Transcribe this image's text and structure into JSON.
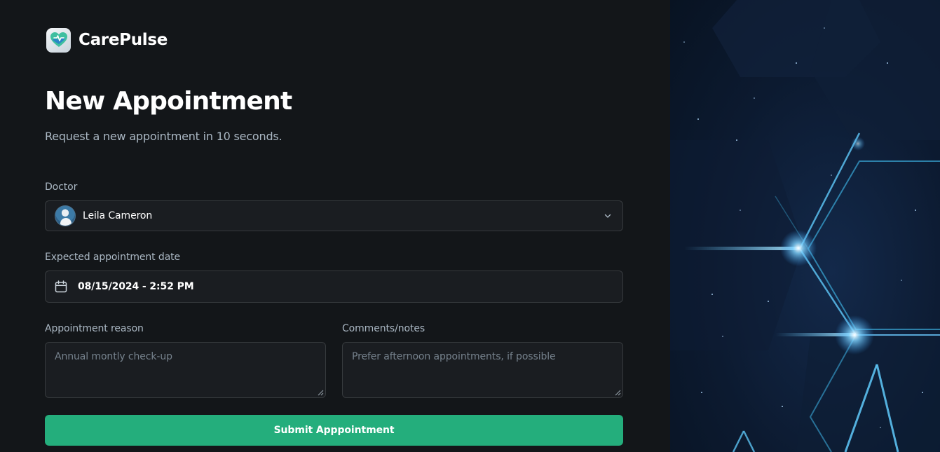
{
  "brand": {
    "name": "CarePulse",
    "accent": "#24ae7c"
  },
  "header": {
    "title": "New Appointment",
    "subtitle": "Request a new appointment in 10 seconds."
  },
  "form": {
    "doctor": {
      "label": "Doctor",
      "value": "Leila Cameron"
    },
    "date": {
      "label": "Expected appointment date",
      "value": "08/15/2024 - 2:52 PM"
    },
    "reason": {
      "label": "Appointment reason",
      "placeholder": "Annual montly check-up"
    },
    "notes": {
      "label": "Comments/notes",
      "placeholder": "Prefer afternoon appointments, if possible"
    },
    "submit_label": "Submit Apppointment"
  },
  "icons": {
    "logo": "carepulse-logo-icon",
    "doctor_avatar": "doctor-avatar",
    "dropdown": "chevron-down-icon",
    "calendar": "calendar-icon"
  }
}
